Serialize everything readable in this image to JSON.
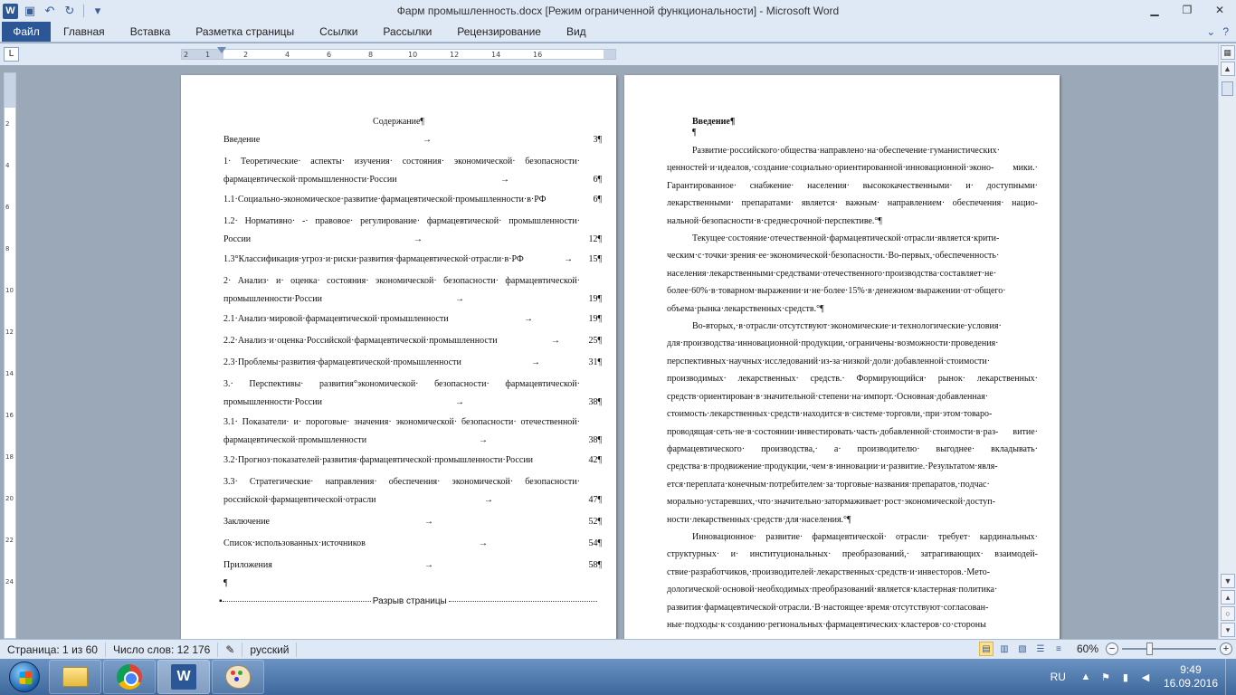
{
  "window": {
    "title": "Фарм промышленность.docx [Режим ограниченной функциональности]  -  Microsoft Word",
    "app_icon": "W"
  },
  "ribbon": {
    "file_tab": "Файл",
    "tabs": [
      "Главная",
      "Вставка",
      "Разметка страницы",
      "Ссылки",
      "Рассылки",
      "Рецензирование",
      "Вид"
    ]
  },
  "ruler": {
    "ticks": [
      "2",
      "1",
      "2",
      "4",
      "6",
      "8",
      "10",
      "12",
      "14",
      "16"
    ]
  },
  "vruler": {
    "ticks": [
      "2",
      "4",
      "6",
      "8",
      "10",
      "12",
      "14",
      "16",
      "18",
      "20",
      "22",
      "24"
    ]
  },
  "page1": {
    "toc_title": "Содержание¶",
    "pilcrow": "¶",
    "page_break": "Разрыв страницы",
    "entries": [
      {
        "text": "Введение",
        "page": "3¶"
      },
      {
        "text": "1· Теоретические· аспекты· изучения· состояния· экономической· безопасности· фармацевтической·промышленности·России",
        "page": "6¶"
      },
      {
        "text": "1.1·Социально-экономическое·развитие·фармацевтической·промышленности·в·РФ",
        "page": "6¶"
      },
      {
        "text": "1.2· Нормативно· -· правовое· регулирование· фармацевтической· промышленности· России",
        "page": "12¶"
      },
      {
        "text": "1.3°Классификация·угроз·и·риски·развития·фармацевтической·отрасли·в·РФ",
        "page": "15¶"
      },
      {
        "text": "2· Анализ· и· оценка· состояния· экономической· безопасности· фармацевтической· промышленности·России",
        "page": "19¶"
      },
      {
        "text": "2.1·Анализ·мировой·фармацевтической·промышленности",
        "page": "19¶"
      },
      {
        "text": "2.2·Анализ·и·оценка·Российской·фармацевтической·промышленности",
        "page": "25¶"
      },
      {
        "text": "2.3·Проблемы·развития·фармацевтической·промышленности",
        "page": "31¶"
      },
      {
        "text": "3.· Перспективы· развития°экономической· безопасности· фармацевтической· промышленности·России",
        "page": "38¶"
      },
      {
        "text": "3.1· Показатели· и· пороговые· значения· экономической· безопасности· отечественной· фармацевтической·промышленности",
        "page": "38¶"
      },
      {
        "text": "3.2·Прогноз·показателей·развития·фармацевтической·промышленности·России",
        "page": "42¶"
      },
      {
        "text": "3.3· Стратегические· направления· обеспечения· экономической· безопасности· российской·фармацевтической·отрасли",
        "page": "47¶"
      },
      {
        "text": "Заключение",
        "page": "52¶"
      },
      {
        "text": "Список·использованных·источников",
        "page": "54¶"
      },
      {
        "text": "Приложения",
        "page": "58¶"
      }
    ]
  },
  "page2": {
    "title": "Введение¶",
    "pilcrow": "¶",
    "paragraphs": [
      "Развитие·российского·общества·направлено·на·обеспечение·гуманистических· ценностей·и·идеалов,·создание·социально·ориентированной·инновационной·эконо- мики.· Гарантированное· снабжение· населения· высококачественными· и· доступными· лекарственными· препаратами· является· важным· направлением· обеспечения· нацио- нальной·безопасности·в·среднесрочной·перспективе.°¶",
      "Текущее·состояние·отечественной·фармацевтической·отрасли·является·крити- ческим·с·точки·зрения·ее·экономической·безопасности.·Во-первых,·обеспеченность· населения·лекарственными·средствами·отечественного·производства·составляет·не· более·60%·в·товарном·выражении·и·не·более·15%·в·денежном·выражении·от·общего· объема·рынка·лекарственных·средств.°¶",
      "Во-вторых,·в·отрасли·отсутствуют·экономические·и·технологические·условия· для·производства·инновационной·продукции,·ограничены·возможности·проведения· перспективных·научных·исследований·из-за·низкой·доли·добавленной·стоимости· производимых· лекарственных· средств.· Формирующийся· рынок· лекарственных· средств·ориентирован·в·значительной·степени·на·импорт.·Основная·добавленная· стоимость·лекарственных·средств·находится·в·системе·торговли,·при·этом·товаро- проводящая·сеть·не·в·состоянии·инвестировать·часть·добавленной·стоимости·в·раз- витие· фармацевтического· производства,· а· производителю· выгоднее· вкладывать· средства·в·продвижение·продукции,·чем·в·инновации·и·развитие.·Результатом·явля- ется·переплата·конечным·потребителем·за·торговые·названия·препаратов,·подчас· морально·устаревших,·что·значительно·затормаживает·рост·экономической·доступ- ности·лекарственных·средств·для·населения.°¶",
      "Инновационное· развитие· фармацевтической· отрасли· требует· кардинальных· структурных· и· институциональных· преобразований,· затрагивающих· взаимодей- ствие·разработчиков,·производителей·лекарственных·средств·и·инвесторов.·Мето- дологической·основой·необходимых·преобразований·является·кластерная·политика· развития·фармацевтической·отрасли.·В·настоящее·время·отсутствуют·согласован- ные·подходы·к·созданию·региональных·фармацевтических·кластеров·со·стороны"
    ]
  },
  "statusbar": {
    "page": "Страница: 1 из 60",
    "words": "Число слов: 12 176",
    "language": "русский",
    "zoom": "60%",
    "zoom_level": 60
  },
  "taskbar": {
    "lang": "RU",
    "time": "9:49",
    "date": "16.09.2016"
  }
}
